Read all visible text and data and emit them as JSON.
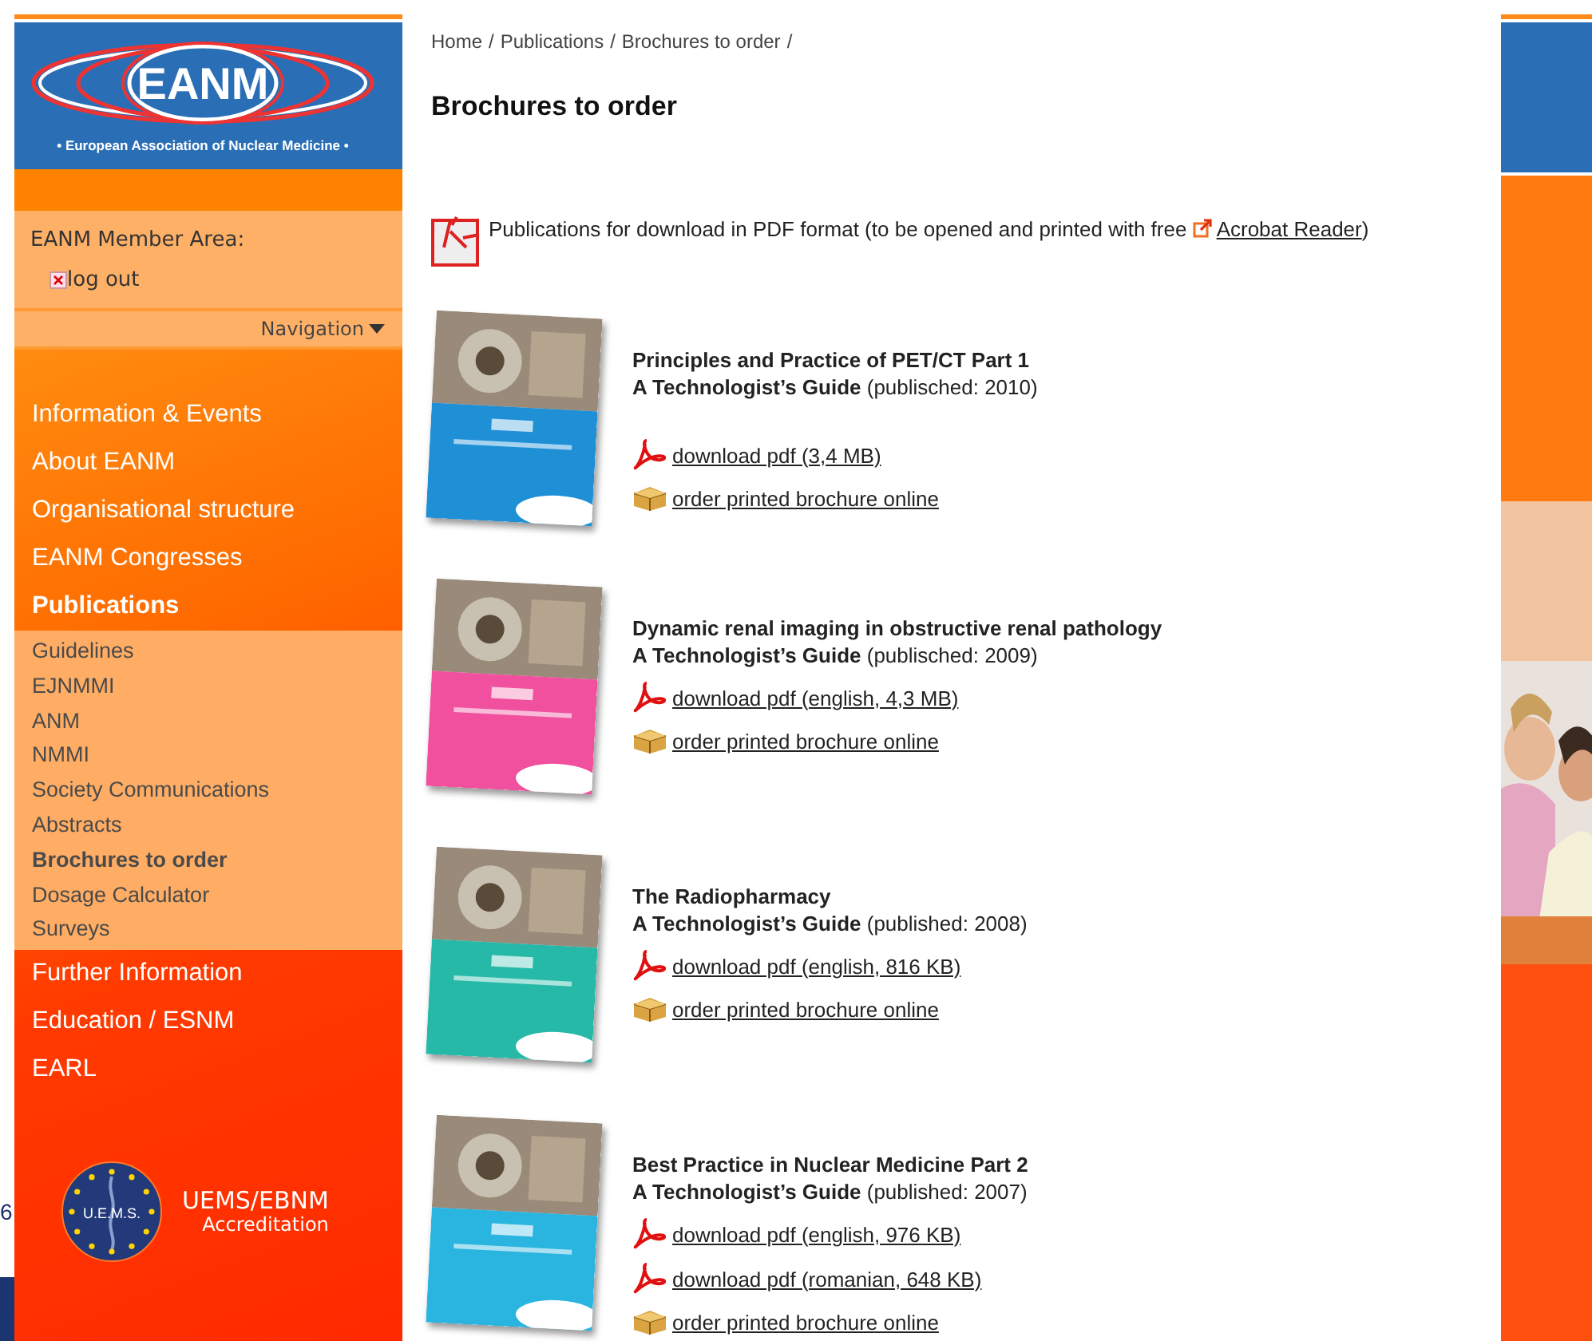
{
  "logo": {
    "name": "EANM",
    "tagline": "• European Association of Nuclear Medicine •"
  },
  "member_area": {
    "title": "EANM Member Area:",
    "logout": "log out"
  },
  "navigation": {
    "label": "Navigation"
  },
  "nav_items": [
    {
      "label": "Information & Events",
      "selected": false
    },
    {
      "label": "About EANM",
      "selected": false
    },
    {
      "label": "Organisational structure",
      "selected": false
    },
    {
      "label": "EANM Congresses",
      "selected": false
    },
    {
      "label": "Publications",
      "selected": true,
      "children": [
        {
          "label": "Guidelines",
          "selected": false
        },
        {
          "label": "EJNMMI",
          "selected": false
        },
        {
          "label": "ANM",
          "selected": false
        },
        {
          "label": "NMMI",
          "selected": false
        },
        {
          "label": "Society Communications",
          "selected": false
        },
        {
          "label": "Abstracts",
          "selected": false
        },
        {
          "label": "Brochures to order",
          "selected": true
        },
        {
          "label": "Dosage Calculator",
          "selected": false
        },
        {
          "label": "Surveys",
          "selected": false
        }
      ]
    },
    {
      "label": "Further Information",
      "selected": false
    },
    {
      "label": "Education / ESNM",
      "selected": false
    },
    {
      "label": "EARL",
      "selected": false
    }
  ],
  "accreditation": {
    "emblem_text": "U.E.M.S.",
    "title": "UEMS/EBNM",
    "subtitle": "Accreditation"
  },
  "background_fragment": "6",
  "breadcrumb": [
    {
      "label": "Home",
      "separator": "/"
    },
    {
      "label": "Publications",
      "separator": "/"
    },
    {
      "label": "Brochures to order",
      "separator": "/"
    }
  ],
  "page_title": "Brochures to order",
  "pdf_note": {
    "text": "Publications for download in PDF format (to be opened and printed with free",
    "link": "Acrobat Reader",
    "after": ")"
  },
  "brochures": [
    {
      "title": "Principles and Practice of PET/CT Part 1",
      "subtitle": "**A Technologist’s Guide** (publisched: 2010)",
      "color": "#1f8fd6",
      "links": [
        {
          "kind": "pdf",
          "label": "download pdf (3,4 MB)"
        },
        {
          "kind": "order",
          "label": "order printed brochure online"
        }
      ]
    },
    {
      "title": "Dynamic renal imaging in obstructive renal pathology",
      "subtitle": "**A Technologist’s Guide** (publisched: 2009)",
      "color": "#f0509e",
      "links": [
        {
          "kind": "pdf",
          "label": "download pdf (english, 4,3 MB)"
        },
        {
          "kind": "order",
          "label": "order printed brochure online"
        }
      ]
    },
    {
      "title": "The Radiopharmacy",
      "subtitle": "**A Technologist’s Guide** (published: 2008)",
      "color": "#26b9a8",
      "links": [
        {
          "kind": "pdf",
          "label": "download pdf (english, 816 KB)"
        },
        {
          "kind": "order",
          "label": "order printed brochure online"
        }
      ]
    },
    {
      "title": "Best Practice in Nuclear Medicine Part 2",
      "subtitle": "**A Technologist’s Guide** (published: 2007)",
      "color": "#2ab4e0",
      "links": [
        {
          "kind": "pdf",
          "label": "download pdf (english, 976 KB)"
        },
        {
          "kind": "pdf",
          "label": "download pdf (romanian, 648 KB)"
        },
        {
          "kind": "order",
          "label": "order printed brochure online"
        }
      ]
    }
  ]
}
